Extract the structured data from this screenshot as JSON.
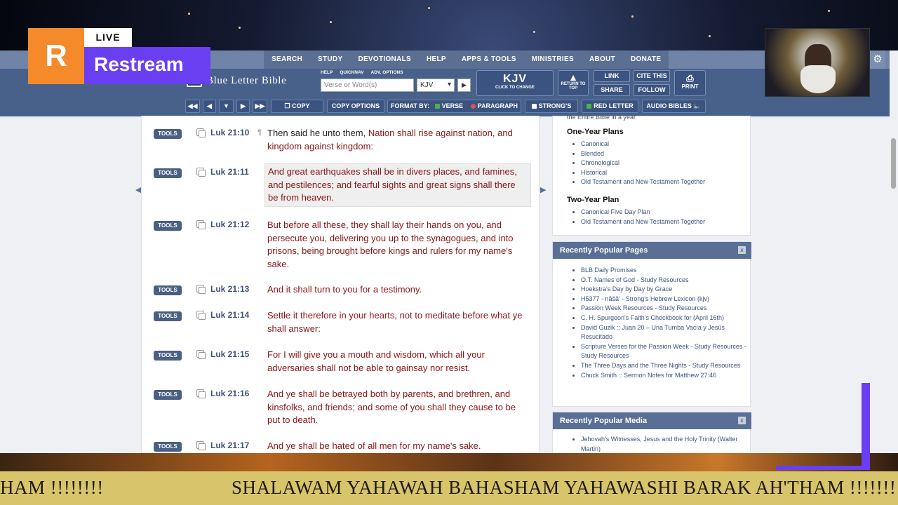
{
  "topnav": [
    "SEARCH",
    "STUDY",
    "DEVOTIONALS",
    "HELP",
    "APPS & TOOLS",
    "MINISTRIES",
    "ABOUT",
    "DONATE"
  ],
  "header": {
    "logo": "Blue Letter Bible",
    "minilinks": [
      "HELP",
      "QUICKNAV",
      "ADV. OPTIONS"
    ],
    "search_placeholder": "Verse or Word(s)",
    "version": "KJV",
    "kjv_big": "KJV",
    "kjv_small": "CLICK TO CHANGE",
    "return_top": "RETURN TO TOP",
    "link": "LINK",
    "cite": "CITE THIS",
    "share": "SHARE",
    "follow": "FOLLOW",
    "print": "PRINT"
  },
  "toolbar": {
    "copy": "COPY",
    "copy_options": "COPY OPTIONS",
    "format_by": "FORMAT BY:",
    "verse": "VERSE",
    "paragraph": "PARAGRAPH",
    "strongs": "STRONG'S",
    "red_letter": "RED LETTER",
    "audio": "AUDIO BIBLES"
  },
  "verses": [
    {
      "ref": "Luk 21:10",
      "pilcrow": "¶",
      "lead": "Then said he unto them, ",
      "text": "Nation shall rise against nation, and kingdom against kingdom:"
    },
    {
      "ref": "Luk 21:11",
      "text": "And great earthquakes shall be in divers places, and famines, and pestilences; and fearful sights and great signs shall there be from heaven."
    },
    {
      "ref": "Luk 21:12",
      "text": "But before all these, they shall lay their hands on you, and persecute you, delivering you up to the synagogues, and into prisons, being brought before kings and rulers for my name's sake."
    },
    {
      "ref": "Luk 21:13",
      "text": "And it shall turn to you for a testimony."
    },
    {
      "ref": "Luk 21:14",
      "text": "Settle it therefore in your hearts, not to meditate before what ye shall answer:"
    },
    {
      "ref": "Luk 21:15",
      "text": "For I will give you a mouth and wisdom, which all your adversaries shall not be able to gainsay nor resist."
    },
    {
      "ref": "Luk 21:16",
      "text": "And ye shall be betrayed both by parents, and brethren, and kinsfolks, and friends; and some of you shall they cause to be put to death."
    },
    {
      "ref": "Luk 21:17",
      "text": "And ye shall be hated of all men for my name's sake."
    }
  ],
  "tools_label": "TOOLS",
  "sidebar": {
    "partial_text": "the Entire Bible in a year.",
    "one_year_title": "One-Year Plans",
    "one_year": [
      "Canonical",
      "Blended",
      "Chronological",
      "Historical",
      "Old Testament and New Testament Together"
    ],
    "two_year_title": "Two-Year Plan",
    "two_year": [
      "Canonical Five Day Plan",
      "Old Testament and New Testament Together"
    ],
    "popular_pages_title": "Recently Popular Pages",
    "popular_pages": [
      "BLB Daily Promises",
      "O.T. Names of God - Study Resources",
      "Hoekstra's Day by Day by Grace",
      "H5377 - nāšā' - Strong's Hebrew Lexicon (kjv)",
      "Passion Week Resources - Study Resources",
      "C. H. Spurgeon's Faith's Checkbook for (April 16th)",
      "David Guzik :: Juan 20 – Una Tumba Vacía y Jesús Resucitado",
      "Scripture Verses for the Passion Week - Study Resources - Study Resources",
      "The Three Days and the Three Nights - Study Resources",
      "Chuck Smith :: Sermon Notes for Matthew 27:46"
    ],
    "popular_media_title": "Recently Popular Media",
    "popular_media": [
      "Jehovah's Witnesses, Jesus and the Holy Trinity (Walter Martin)"
    ],
    "close": "x"
  },
  "overlay": {
    "r": "R",
    "live": "LIVE",
    "restream": "Restream",
    "ticker_left": "HAM !!!!!!!!",
    "ticker_main": "SHALAWAM YAHAWAH BAHASHAM YAHAWASHI BARAK AH'THAM !!!!!!!!"
  },
  "colors": {
    "accent": "#48618b",
    "red_letter": "#8b1414",
    "restream_purple": "#6a3ff2",
    "restream_orange": "#f58a2a",
    "ticker": "#d8c46a"
  }
}
